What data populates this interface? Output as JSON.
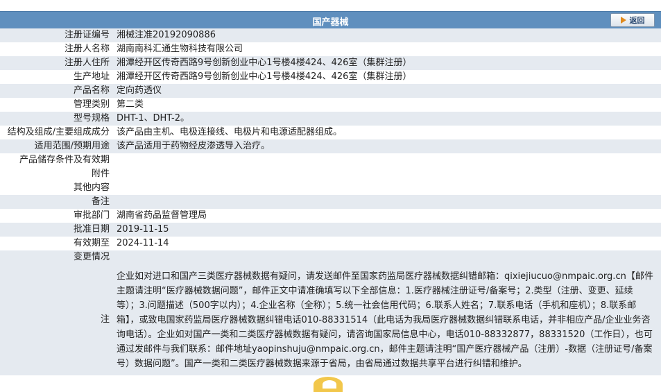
{
  "header": {
    "title": "国产器械",
    "back_label": "返回"
  },
  "fields": [
    {
      "label": "注册证编号",
      "value": "湘械注准20192090886"
    },
    {
      "label": "注册人名称",
      "value": "湖南南科汇通生物科技有限公司"
    },
    {
      "label": "注册人住所",
      "value": "湘潭经开区传奇西路9号创新创业中心1号楼4楼424、426室（集群注册）"
    },
    {
      "label": "生产地址",
      "value": "湘潭经开区传奇西路9号创新创业中心1号楼4楼424、426室（集群注册）"
    },
    {
      "label": "产品名称",
      "value": "定向药透仪"
    },
    {
      "label": "管理类别",
      "value": "第二类"
    },
    {
      "label": "型号规格",
      "value": "DHT-1、DHT-2。"
    },
    {
      "label": "结构及组成/主要组成成分",
      "value": "该产品由主机、电极连接线、电极片和电源适配器组成。"
    },
    {
      "label": "适用范围/预期用途",
      "value": "该产品适用于药物经皮渗透导入治疗。"
    },
    {
      "label": "产品储存条件及有效期",
      "value": ""
    },
    {
      "label": "附件",
      "value": ""
    },
    {
      "label": "其他内容",
      "value": ""
    },
    {
      "label": "备注",
      "value": ""
    },
    {
      "label": "审批部门",
      "value": "湖南省药品监督管理局"
    },
    {
      "label": "批准日期",
      "value": "2019-11-15"
    },
    {
      "label": "有效期至",
      "value": "2024-11-14"
    },
    {
      "label": "变更情况",
      "value": ""
    }
  ],
  "note": {
    "label": "注",
    "text": "企业如对进口和国产三类医疗器械数据有疑问，请发送邮件至国家药监局医疗器械数据纠错邮箱：qixiejiucuo@nmpaic.org.cn【邮件主题请注明“医疗器械数据问题”，邮件正文中请准确填写以下全部信息：1.医疗器械注册证号/备案号；2.类型（注册、变更、延续等）；3.问题描述（500字以内）；4.企业名称（全称）；5.统一社会信用代码；6.联系人姓名；7.联系电话（手机和座机）；8.联系邮箱】，或致电国家药监局医疗器械数据纠错电话010-88331514（此电话为我局医疗器械数据纠错联系电话，并非相应产品/企业业务咨询电话）。企业如对国产一类和二类医疗器械数据有疑问，请咨询国家局信息中心，电话010-88332877，88331520（工作日），也可通过发邮件与我们联系：邮件地址yaopinshuju@nmpaic.org.cn，邮件主题请注明“国产医疗器械产品（注册）-数据（注册证号/备案号）数据问题”。国产一类和二类医疗器械数据来源于省局，由省局通过数据共享平台进行纠错和维护。"
  },
  "colors": {
    "header_bg": "#5f8fbe",
    "row_shade": "#e5eaf0",
    "back_arrow": "#e08a1e"
  }
}
